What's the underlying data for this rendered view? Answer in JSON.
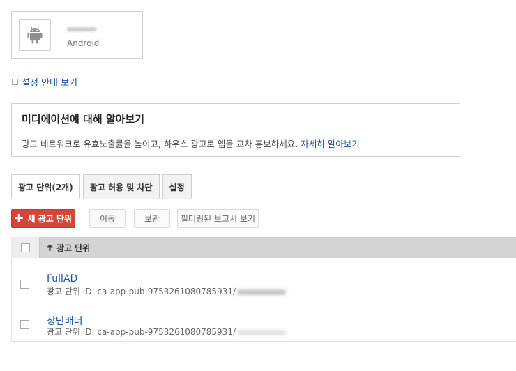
{
  "app": {
    "platform": "Android",
    "icon": "android-icon"
  },
  "guide_link": "설정 안내 보기",
  "info": {
    "title": "미디에이션에 대해 알아보기",
    "text": "광고 네트워크로 유효노출률을 높이고, 하우스 광고로 앱을 교차 홍보하세요.",
    "link": "자세히 알아보기"
  },
  "tabs": [
    "광고 단위(2개)",
    "광고 허용 및 차단",
    "설정"
  ],
  "toolbar": {
    "new_unit": "새 광고 단위",
    "move": "이동",
    "archive": "보관",
    "filtered_report": "필터링된 보고서 보기"
  },
  "table": {
    "header": "광고 단위",
    "rows": [
      {
        "name": "FullAD",
        "id": "광고 단위 ID: ca-app-pub-9753261080785931/"
      },
      {
        "name": "상단배너",
        "id": "광고 단위 ID: ca-app-pub-9753261080785931/"
      }
    ]
  },
  "colors": {
    "accent": "#d2473a",
    "link": "#1a4fa0"
  }
}
